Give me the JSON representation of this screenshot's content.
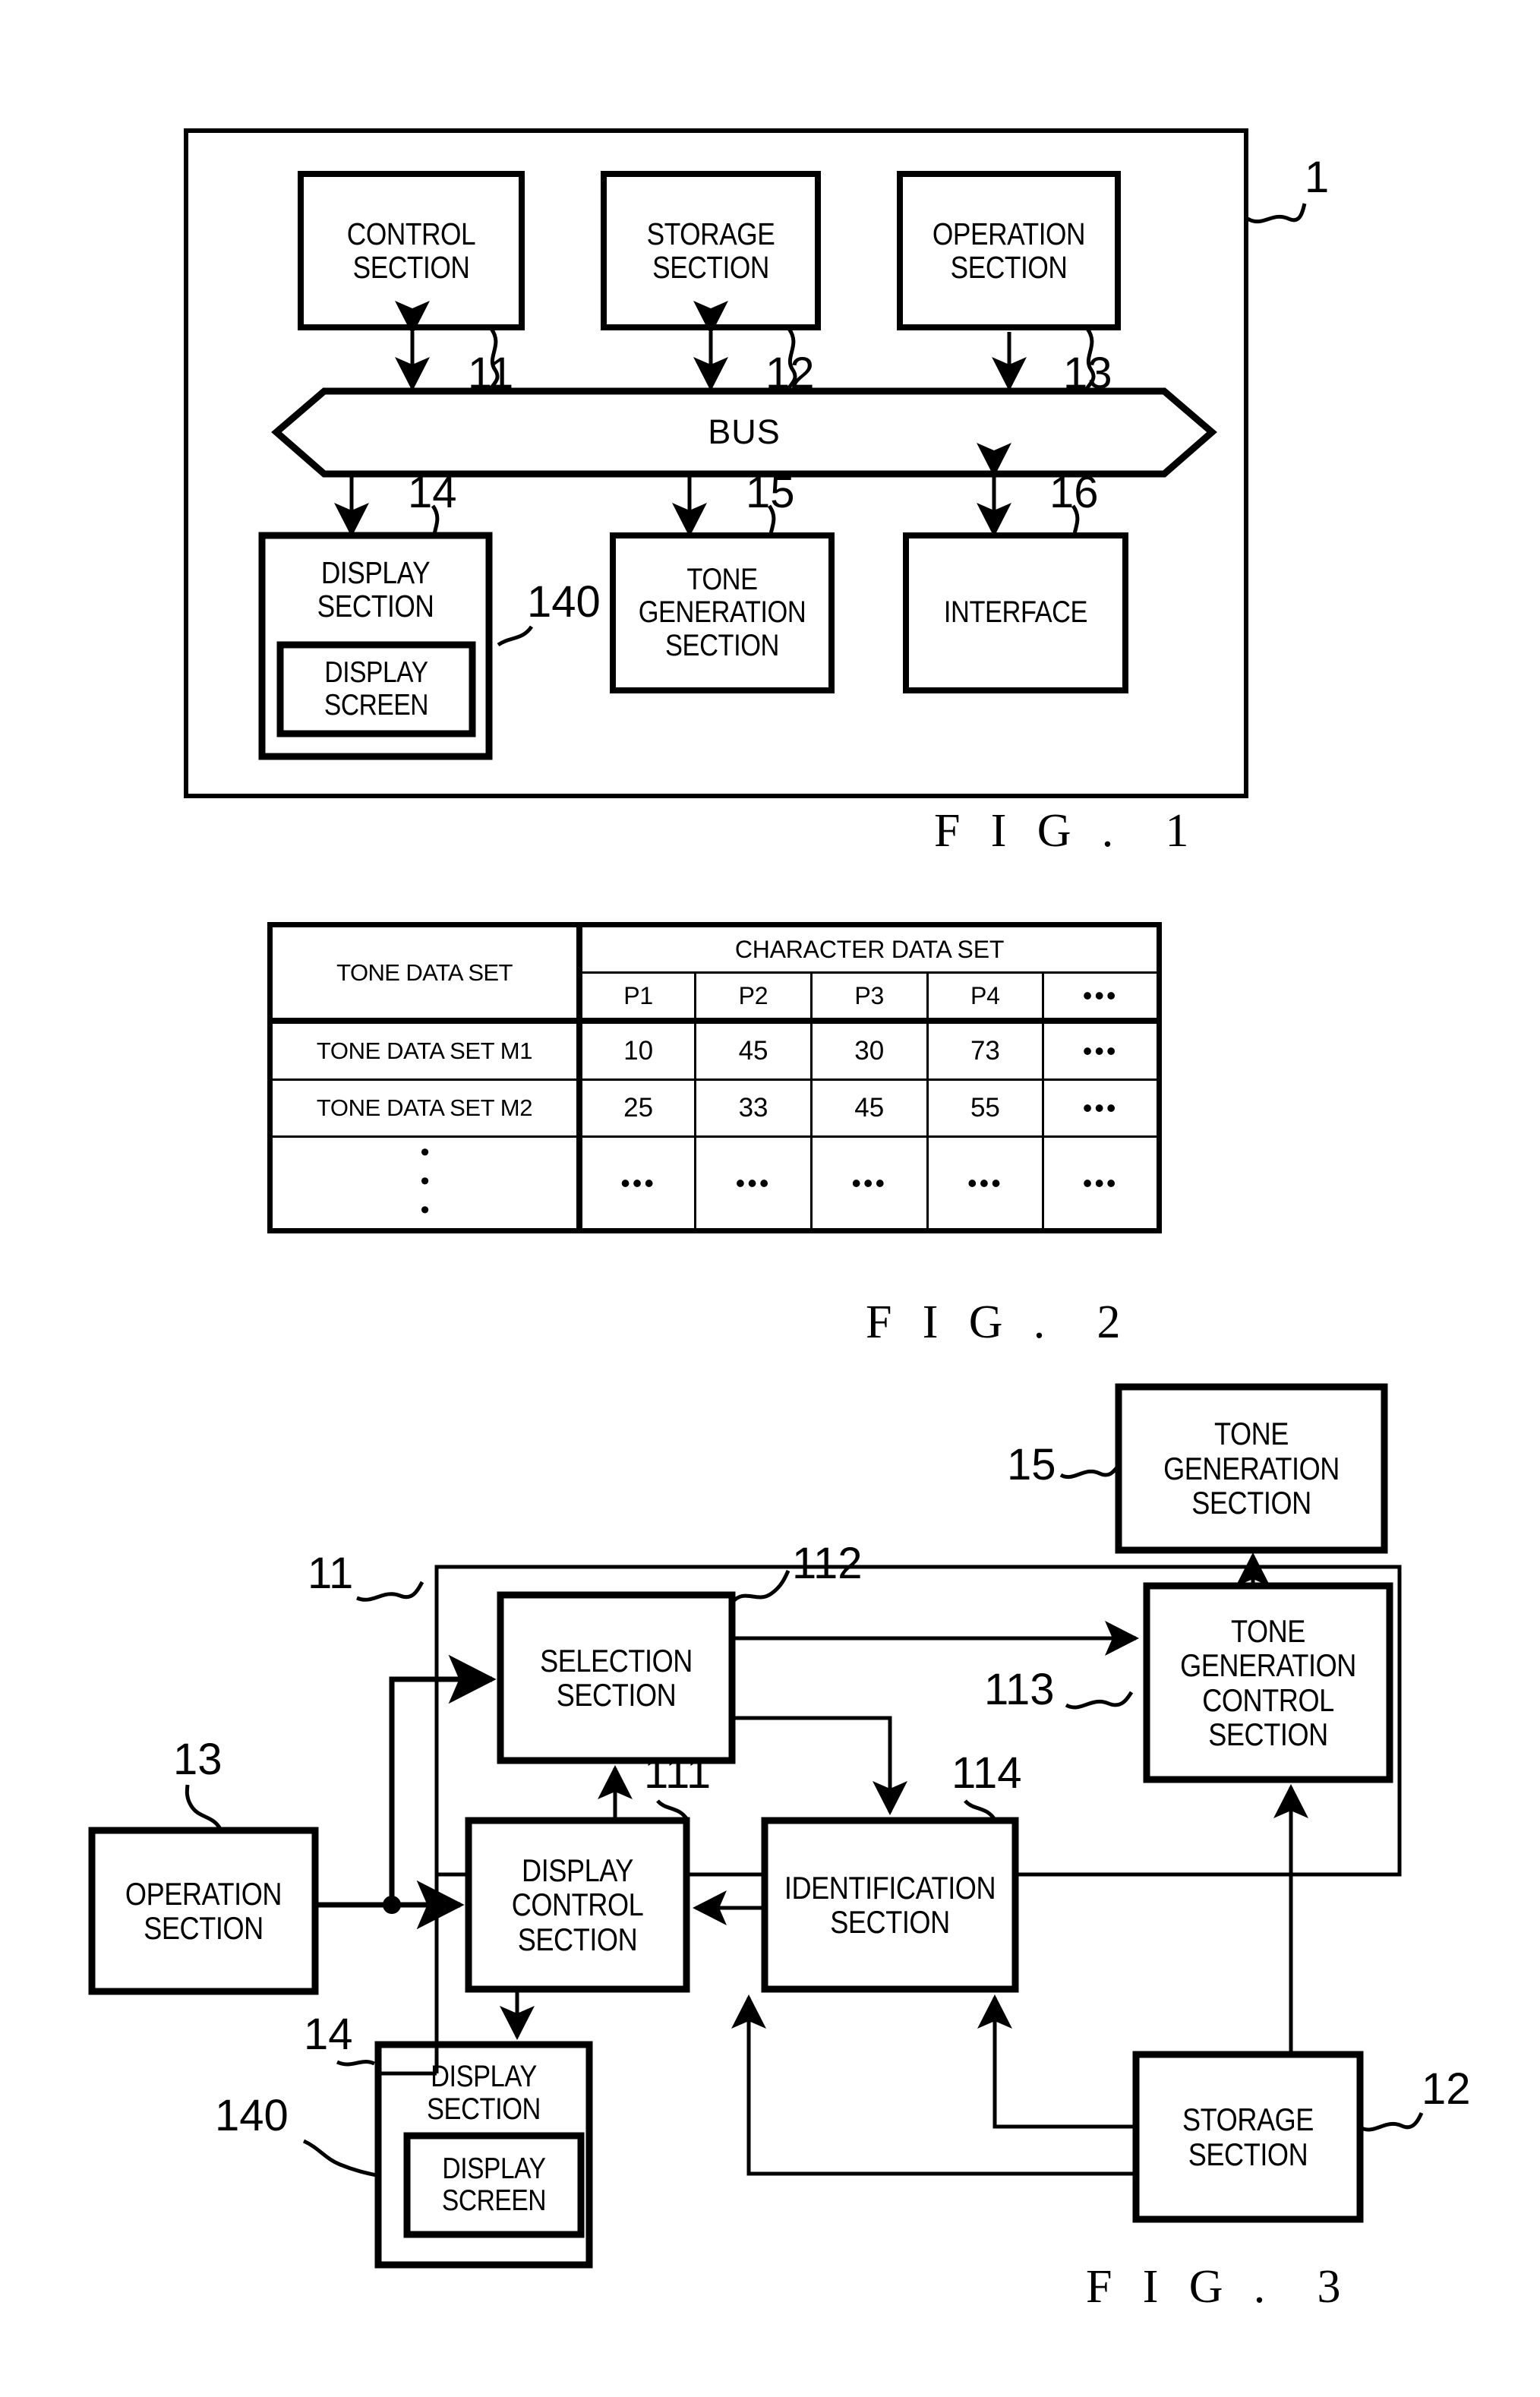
{
  "figures": [
    {
      "caption": "F I G .  1",
      "system_ref": "1",
      "blocks": {
        "control_section": "CONTROL\nSECTION",
        "storage_section": "STORAGE\nSECTION",
        "operation_section": "OPERATION\nSECTION",
        "bus": "BUS",
        "display_section": "DISPLAY\nSECTION",
        "display_screen": "DISPLAY\nSCREEN",
        "tone_generation_section": "TONE\nGENERATION\nSECTION",
        "interface": "INTERFACE"
      },
      "ref_numbers": {
        "control_section": "11",
        "storage_section": "12",
        "operation_section": "13",
        "display_section": "14",
        "display_screen": "140",
        "tone_generation_section": "15",
        "interface": "16"
      }
    },
    {
      "caption": "F I G .  2",
      "table": {
        "corner_header": "TONE DATA SET",
        "group_header": "CHARACTER DATA SET",
        "column_headers": [
          "P1",
          "P2",
          "P3",
          "P4",
          "•••"
        ],
        "rows": [
          {
            "label": "TONE DATA SET M1",
            "values": [
              "10",
              "45",
              "30",
              "73",
              "•••"
            ]
          },
          {
            "label": "TONE DATA SET M2",
            "values": [
              "25",
              "33",
              "45",
              "55",
              "•••"
            ]
          },
          {
            "label": "•••",
            "values": [
              "•••",
              "•••",
              "•••",
              "•••",
              "•••"
            ]
          }
        ]
      }
    },
    {
      "caption": "F I G .  3",
      "blocks": {
        "tone_generation_section": "TONE\nGENERATION\nSECTION",
        "selection_section": "SELECTION\nSECTION",
        "tone_generation_control_section": "TONE\nGENERATION\nCONTROL\nSECTION",
        "operation_section": "OPERATION\nSECTION",
        "display_control_section": "DISPLAY\nCONTROL\nSECTION",
        "identification_section": "IDENTIFICATION\nSECTION",
        "display_section": "DISPLAY\nSECTION",
        "display_screen": "DISPLAY\nSCREEN",
        "storage_section": "STORAGE\nSECTION"
      },
      "ref_numbers": {
        "tone_generation_section": "15",
        "control_section_container": "11",
        "selection_section": "112",
        "tone_generation_control_section": "113",
        "display_control_section": "111",
        "identification_section": "114",
        "operation_section": "13",
        "display_section": "14",
        "display_screen": "140",
        "storage_section": "12"
      }
    }
  ]
}
